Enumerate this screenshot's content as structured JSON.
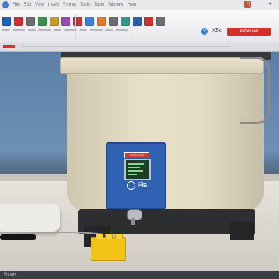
{
  "titlebar": {
    "menu": [
      "File",
      "Edit",
      "View",
      "Insert",
      "Format",
      "Tools",
      "Table",
      "Window",
      "Help"
    ],
    "minimize_label": "▢",
    "close_label": "✕"
  },
  "ribbon": {
    "tools": [
      {
        "icon": "save-icon",
        "color": "#1f5fbf"
      },
      {
        "icon": "youtube-icon",
        "color": "#d0312d"
      },
      {
        "icon": "cut-icon",
        "color": "#6b6b73"
      },
      {
        "icon": "copy-icon",
        "color": "#3a8f4a"
      },
      {
        "icon": "paste-icon",
        "color": "#c79b2a"
      },
      {
        "icon": "format-icon",
        "color": "#9a4ab5"
      },
      {
        "icon": "table-icon",
        "color": "#d0312d"
      },
      {
        "icon": "image-icon",
        "color": "#3d7fd6"
      },
      {
        "icon": "chart-icon",
        "color": "#e07a2d"
      },
      {
        "icon": "link-icon",
        "color": "#6b6b73"
      },
      {
        "icon": "shape-icon",
        "color": "#2f9a8a"
      },
      {
        "icon": "text-icon",
        "color": "#1f5fbf"
      },
      {
        "icon": "bookmark-icon",
        "color": "#d0312d"
      },
      {
        "icon": "comment-icon",
        "color": "#6b6b73"
      }
    ],
    "help_label": "?",
    "zoom_text": "X5c",
    "action_label": "Download"
  },
  "panel": {
    "label": "SETTINGS",
    "text": "Fla"
  },
  "bottombar": {
    "text": "Ready"
  }
}
